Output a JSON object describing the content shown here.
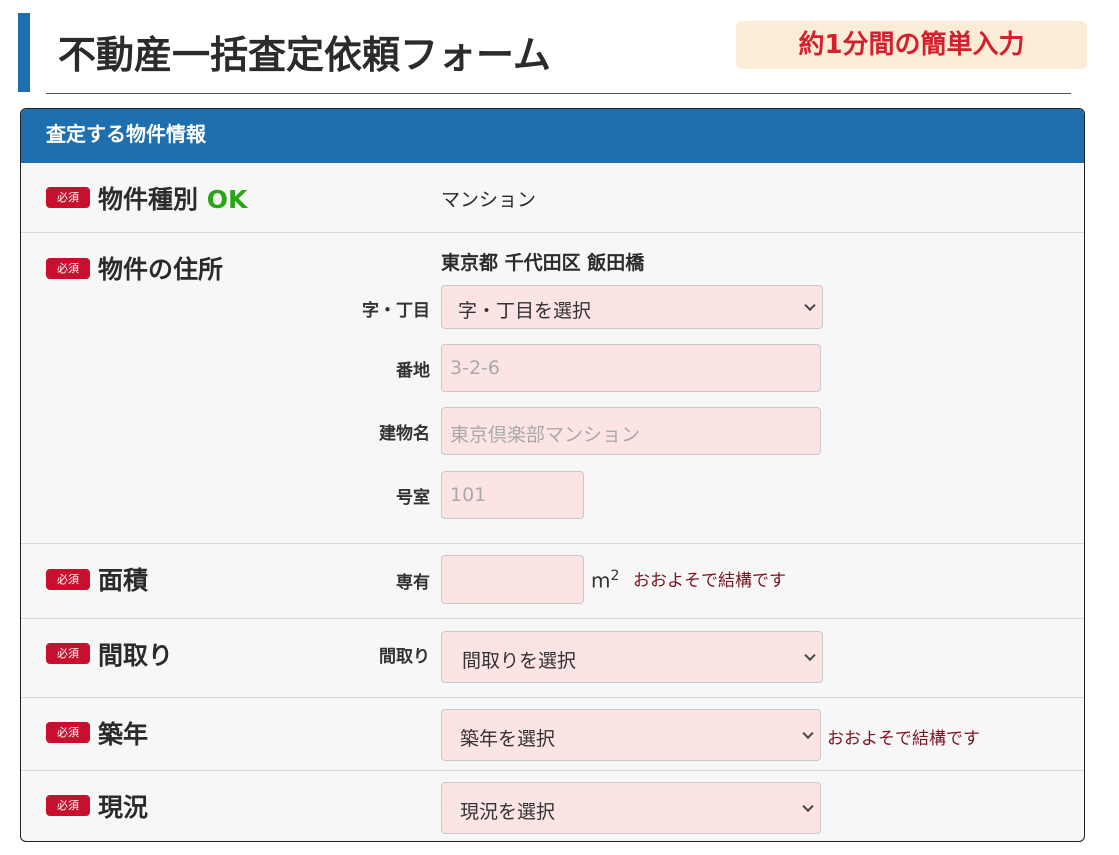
{
  "header": {
    "title": "不動産一括査定依頼フォーム",
    "badge": "約1分間の簡単入力"
  },
  "panel": {
    "heading": "査定する物件情報",
    "required_label": "必須"
  },
  "property_type": {
    "label": "物件種別",
    "status": "OK",
    "value": "マンション"
  },
  "address": {
    "label": "物件の住所",
    "value": "東京都 千代田区 飯田橋",
    "chome_label": "字・丁目",
    "chome_select": "字・丁目を選択",
    "banchi_label": "番地",
    "banchi_placeholder": "3-2-6",
    "building_label": "建物名",
    "building_placeholder": "東京倶楽部マンション",
    "room_label": "号室",
    "room_placeholder": "101"
  },
  "area": {
    "label": "面積",
    "sub_label": "専有",
    "unit": "m",
    "unit_sup": "2",
    "note": "おおよそで結構です"
  },
  "layout": {
    "label": "間取り",
    "sub_label": "間取り",
    "select": "間取りを選択"
  },
  "built_year": {
    "label": "築年",
    "select": "築年を選択",
    "note": "おおよそで結構です"
  },
  "status": {
    "label": "現況",
    "select": "現況を選択"
  },
  "colors": {
    "accent_blue": "#1e6fb0",
    "required_red": "#c8102e",
    "ok_green": "#2aa516",
    "field_pink": "#fde4e4"
  }
}
